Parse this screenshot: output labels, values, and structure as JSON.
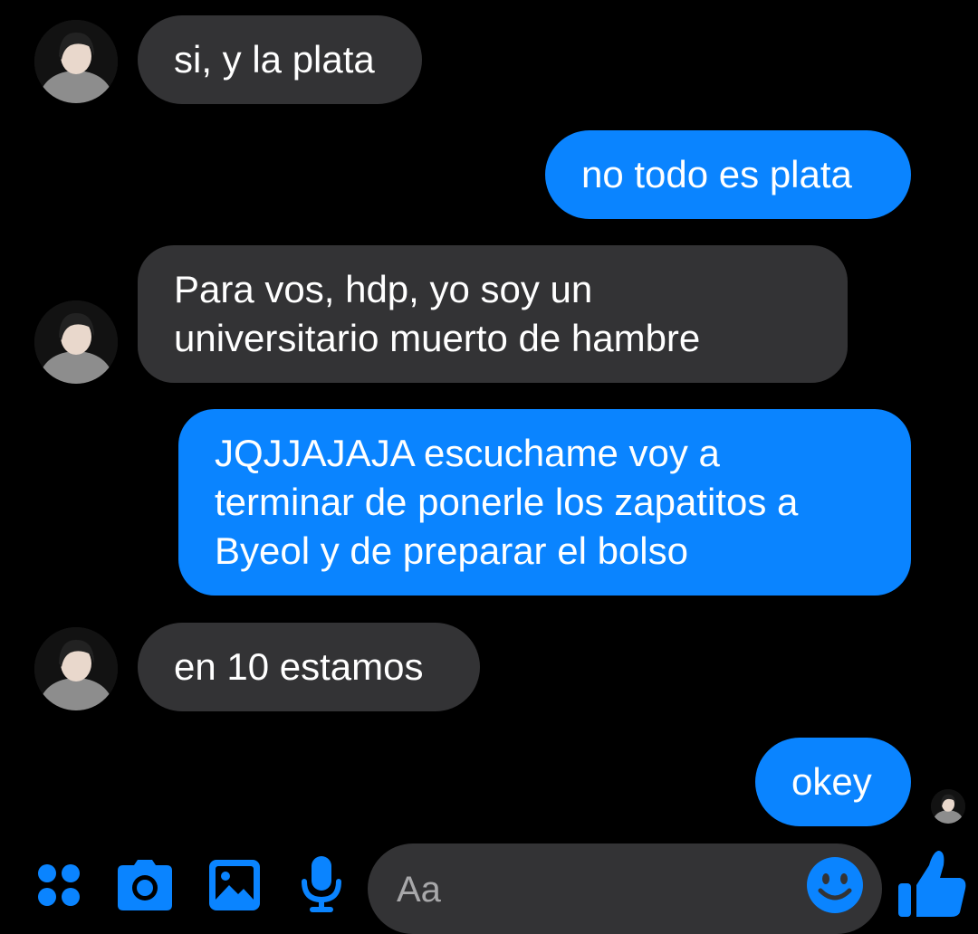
{
  "messages": [
    {
      "side": "incoming",
      "text": "si, y la plata"
    },
    {
      "side": "outgoing",
      "text": "no todo es plata"
    },
    {
      "side": "incoming",
      "text": "Para vos, hdp, yo soy un\nuniversitario muerto de hambre"
    },
    {
      "side": "outgoing",
      "text": "JQJJAJAJA escuchame voy a\nterminar de ponerle los zapatitos a\nByeol y de preparar el bolso"
    },
    {
      "side": "incoming",
      "text": "en 10 estamos"
    },
    {
      "side": "outgoing",
      "text": "okey"
    }
  ],
  "composer": {
    "placeholder": "Aa",
    "icons": [
      "apps-icon",
      "camera-icon",
      "gallery-icon",
      "microphone-icon",
      "emoji-icon",
      "thumbs-up-icon"
    ]
  },
  "colors": {
    "background": "#000000",
    "incoming_bubble": "#333335",
    "outgoing_bubble": "#0a84ff",
    "accent": "#0a84ff",
    "placeholder": "#a8a8aa"
  }
}
